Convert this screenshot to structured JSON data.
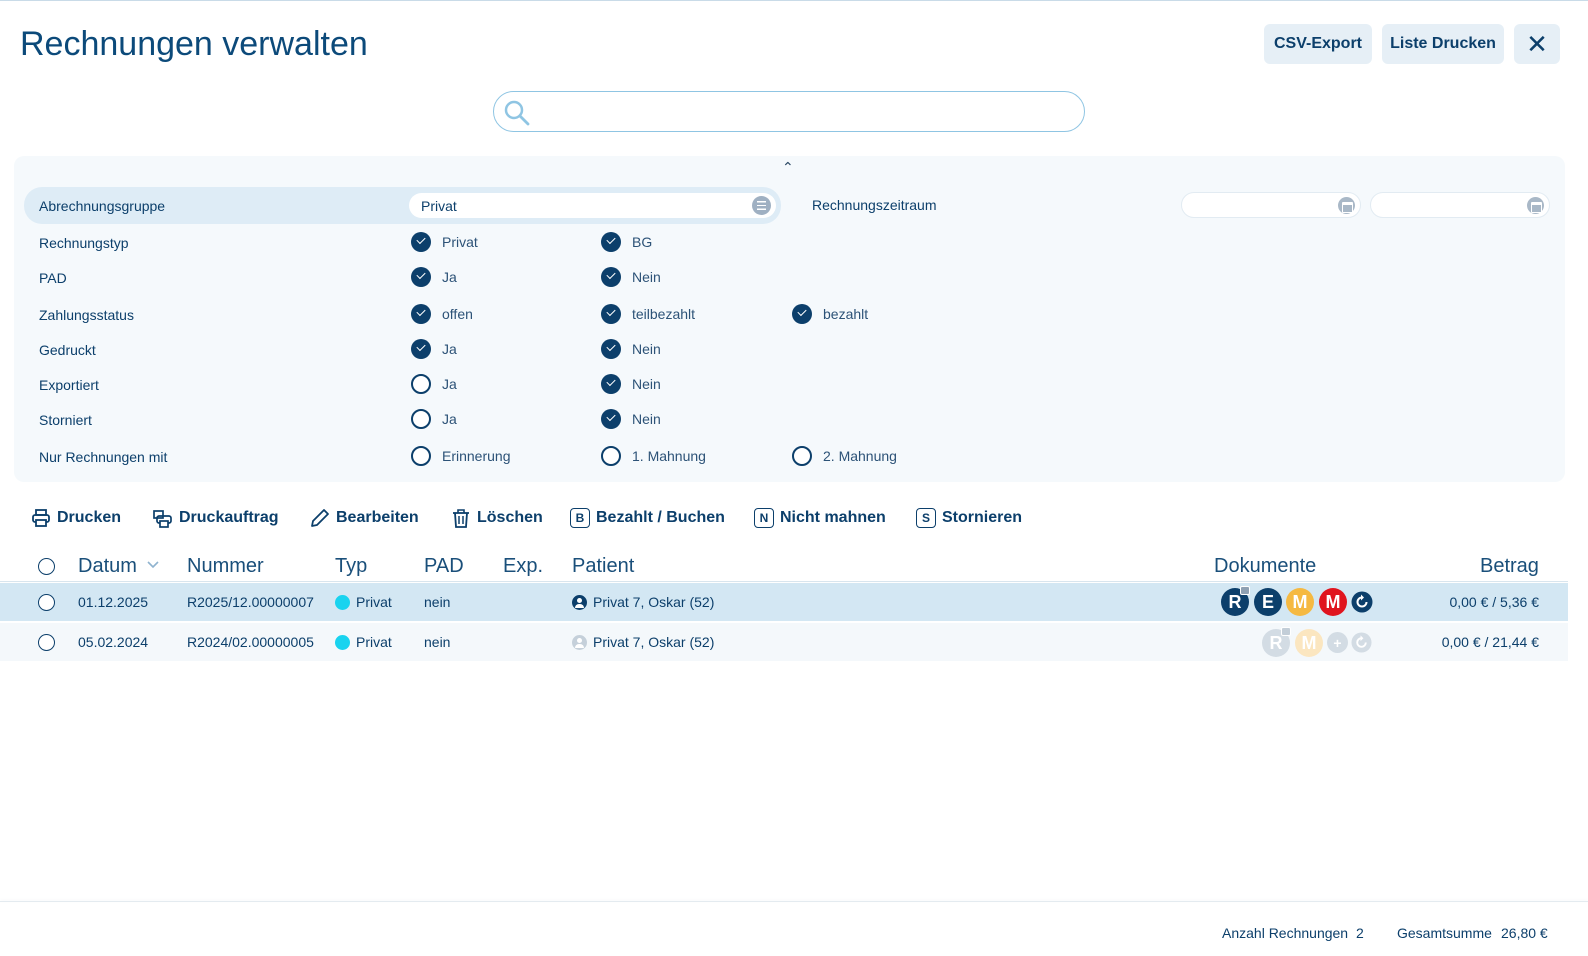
{
  "header": {
    "title": "Rechnungen verwalten",
    "csv_export": "CSV-Export",
    "print_list": "Liste Drucken",
    "close": "✕"
  },
  "search": {
    "placeholder": "",
    "value": ""
  },
  "filters": {
    "collapse_icon": "chevron-up-icon",
    "abrechnungsgruppe": {
      "label": "Abrechnungsgruppe",
      "value": "Privat"
    },
    "rechnungszeitraum": {
      "label": "Rechnungszeitraum",
      "from": "",
      "to": ""
    },
    "rows": [
      {
        "label": "Rechnungstyp",
        "options": [
          {
            "label": "Privat",
            "checked": true
          },
          {
            "label": "BG",
            "checked": true
          }
        ]
      },
      {
        "label": "PAD",
        "options": [
          {
            "label": "Ja",
            "checked": true
          },
          {
            "label": "Nein",
            "checked": true
          }
        ]
      },
      {
        "label": "Zahlungsstatus",
        "options": [
          {
            "label": "offen",
            "checked": true
          },
          {
            "label": "teilbezahlt",
            "checked": true
          },
          {
            "label": "bezahlt",
            "checked": true
          }
        ]
      },
      {
        "label": "Gedruckt",
        "options": [
          {
            "label": "Ja",
            "checked": true
          },
          {
            "label": "Nein",
            "checked": true
          }
        ]
      },
      {
        "label": "Exportiert",
        "options": [
          {
            "label": "Ja",
            "checked": false
          },
          {
            "label": "Nein",
            "checked": true
          }
        ]
      },
      {
        "label": "Storniert",
        "options": [
          {
            "label": "Ja",
            "checked": false
          },
          {
            "label": "Nein",
            "checked": true
          }
        ]
      },
      {
        "label": "Nur Rechnungen mit",
        "options": [
          {
            "label": "Erinnerung",
            "checked": false
          },
          {
            "label": "1. Mahnung",
            "checked": false
          },
          {
            "label": "2. Mahnung",
            "checked": false
          }
        ]
      }
    ]
  },
  "toolbar": {
    "drucken": "Drucken",
    "druckauftrag": "Druckauftrag",
    "bearbeiten": "Bearbeiten",
    "loeschen": "Löschen",
    "bezahlt": "Bezahlt / Buchen",
    "bezahlt_key": "B",
    "nicht_mahnen": "Nicht mahnen",
    "nicht_mahnen_key": "N",
    "stornieren": "Stornieren",
    "stornieren_key": "S"
  },
  "table": {
    "columns": {
      "datum": "Datum",
      "nummer": "Nummer",
      "typ": "Typ",
      "pad": "PAD",
      "exp": "Exp.",
      "patient": "Patient",
      "dokumente": "Dokumente",
      "betrag": "Betrag"
    },
    "sort_icon": "chevron-down-icon",
    "rows": [
      {
        "datum": "01.12.2025",
        "nummer": "R2025/12.00000007",
        "typ": "Privat",
        "pad": "nein",
        "exp": "",
        "patient": "Privat 7, Oskar (52)",
        "betrag": "0,00 € / 5,36 €",
        "selected": true,
        "docs": [
          "R",
          "E",
          "M",
          "M"
        ]
      },
      {
        "datum": "05.02.2024",
        "nummer": "R2024/02.00000005",
        "typ": "Privat",
        "pad": "nein",
        "exp": "",
        "patient": "Privat 7, Oskar (52)",
        "betrag": "0,00 € / 21,44 €",
        "selected": false,
        "docs": [
          "R",
          "M",
          "+"
        ]
      }
    ]
  },
  "footer": {
    "anzahl_label": "Anzahl Rechnungen",
    "anzahl_value": "2",
    "summe_label": "Gesamtsumme",
    "summe_value": "26,80 €"
  },
  "colors": {
    "primary": "#0c3f6b",
    "accent_cyan": "#19d3ef",
    "doc_e": "#0c3f6b",
    "doc_m_orange": "#f5b942",
    "doc_m_red": "#e0141e",
    "selected_row": "#d3e7f3"
  }
}
